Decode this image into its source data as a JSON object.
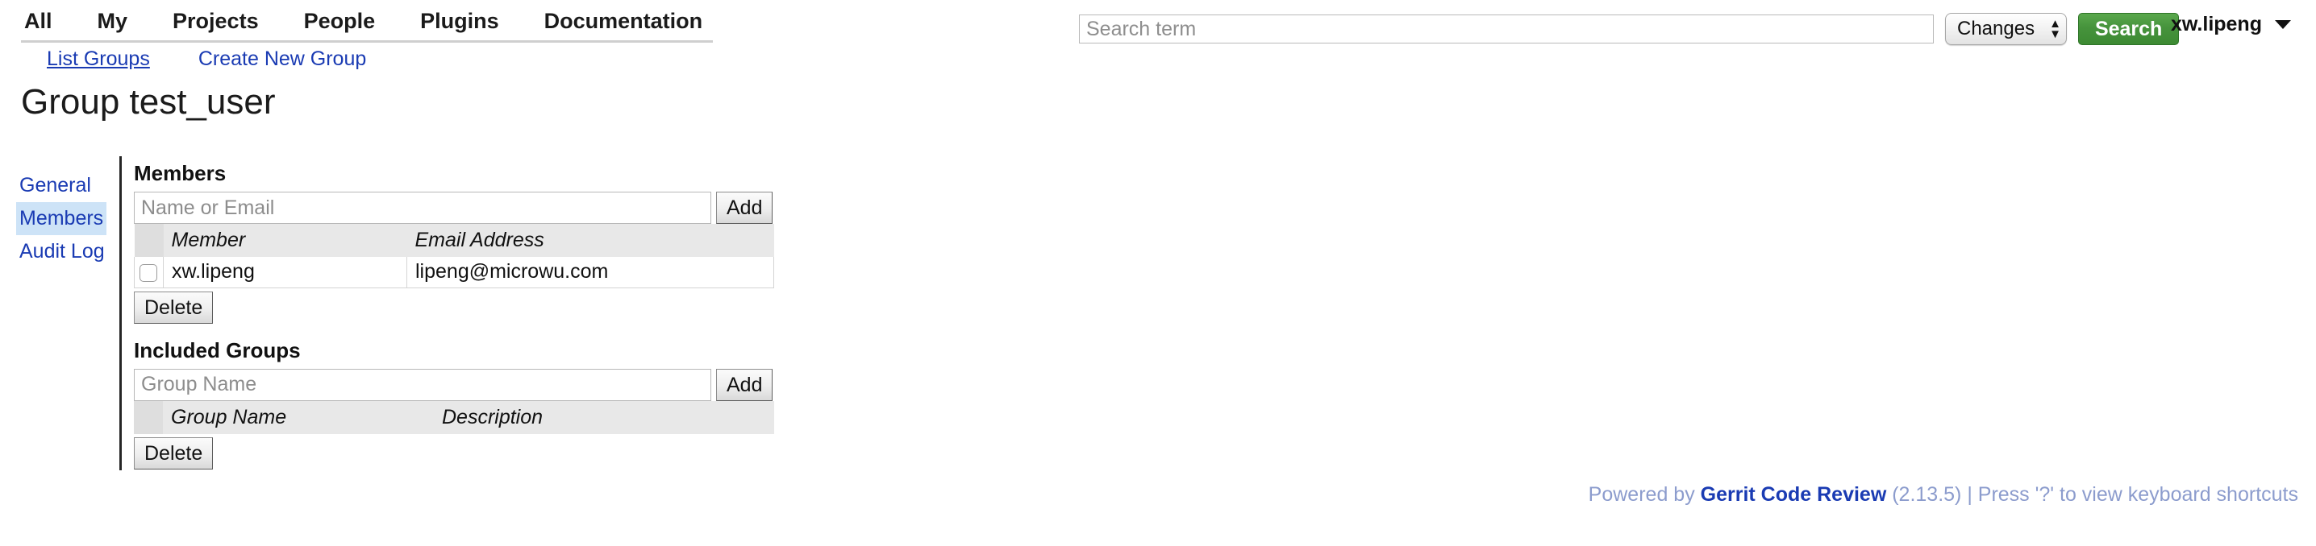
{
  "header": {
    "menu": [
      {
        "label": "All"
      },
      {
        "label": "My"
      },
      {
        "label": "Projects"
      },
      {
        "label": "People"
      },
      {
        "label": "Plugins"
      },
      {
        "label": "Documentation"
      }
    ],
    "submenu": [
      {
        "label": "List Groups",
        "active": true
      },
      {
        "label": "Create New Group",
        "active": false
      }
    ],
    "search": {
      "placeholder": "Search term",
      "value": "",
      "type_selected": "Changes",
      "type_options": [
        "Changes",
        "Projects",
        "People"
      ],
      "button_label": "Search"
    },
    "user": {
      "name": "xw.lipeng",
      "caret_icon": "chevron-down-icon"
    }
  },
  "page": {
    "title": "Group test_user"
  },
  "sidebar": {
    "items": [
      {
        "label": "General",
        "selected": false
      },
      {
        "label": "Members",
        "selected": true
      },
      {
        "label": "Audit Log",
        "selected": false
      }
    ]
  },
  "members": {
    "title": "Members",
    "add_placeholder": "Name or Email",
    "add_value": "",
    "add_button": "Add",
    "columns": [
      "",
      "Member",
      "Email Address"
    ],
    "rows": [
      {
        "checked": false,
        "member": "xw.lipeng",
        "email": "lipeng@microwu.com"
      }
    ],
    "delete_button": "Delete"
  },
  "included_groups": {
    "title": "Included Groups",
    "add_placeholder": "Group Name",
    "add_value": "",
    "add_button": "Add",
    "columns": [
      "",
      "Group Name",
      "Description"
    ],
    "rows": [],
    "delete_button": "Delete"
  },
  "footer": {
    "prefix": "Powered by ",
    "link": "Gerrit Code Review",
    "suffix": " (2.13.5) | Press '?' to view keyboard shortcuts"
  },
  "colors": {
    "link": "#1a3bb3",
    "search_button": "#46933c",
    "selected_bg": "#cde3f7",
    "header_bg": "#e8e8e8",
    "footer_text": "#8c9ccd"
  }
}
